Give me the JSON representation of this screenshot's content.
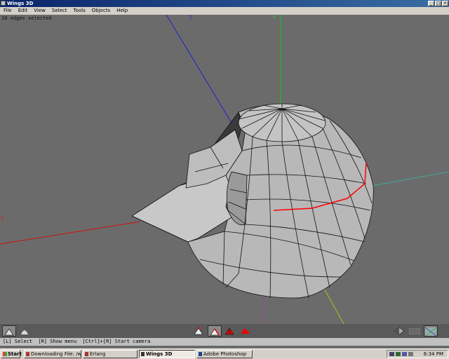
{
  "window": {
    "title": "Wings 3D"
  },
  "menu": [
    "File",
    "Edit",
    "View",
    "Select",
    "Tools",
    "Objects",
    "Help"
  ],
  "viewport": {
    "status": "10 edges selected",
    "axis_labels": {
      "x": "X",
      "y": "Y",
      "z": "Z"
    }
  },
  "helpbar": {
    "hint1": "[L] Select",
    "hint2": "[R] Show menu",
    "hint3": "[Ctrl]+[R] Start camera"
  },
  "taskbar": {
    "start": "Start",
    "tasks": [
      "Downloading File: /wings/...",
      "Erlang",
      "Wings 3D",
      "Adobe Photoshop"
    ],
    "clock": "6:34 PM"
  },
  "colors": {
    "viewport_bg": "#6b6b6b",
    "mesh_face": "#b4b4b4",
    "selected_edge": "#ff0000",
    "axis_x": "#cc1111",
    "axis_y": "#11cc11",
    "axis_z": "#2222cc"
  },
  "toolbar": {
    "left_icons": [
      "shaded-view-icon",
      "smooth-view-icon"
    ],
    "mode_icons": [
      "vertex-mode-icon",
      "edge-mode-icon",
      "face-mode-icon",
      "body-mode-icon"
    ],
    "right_icons": [
      "ground-plane-icon",
      "axes-toggle-icon",
      "orthographic-icon"
    ]
  }
}
